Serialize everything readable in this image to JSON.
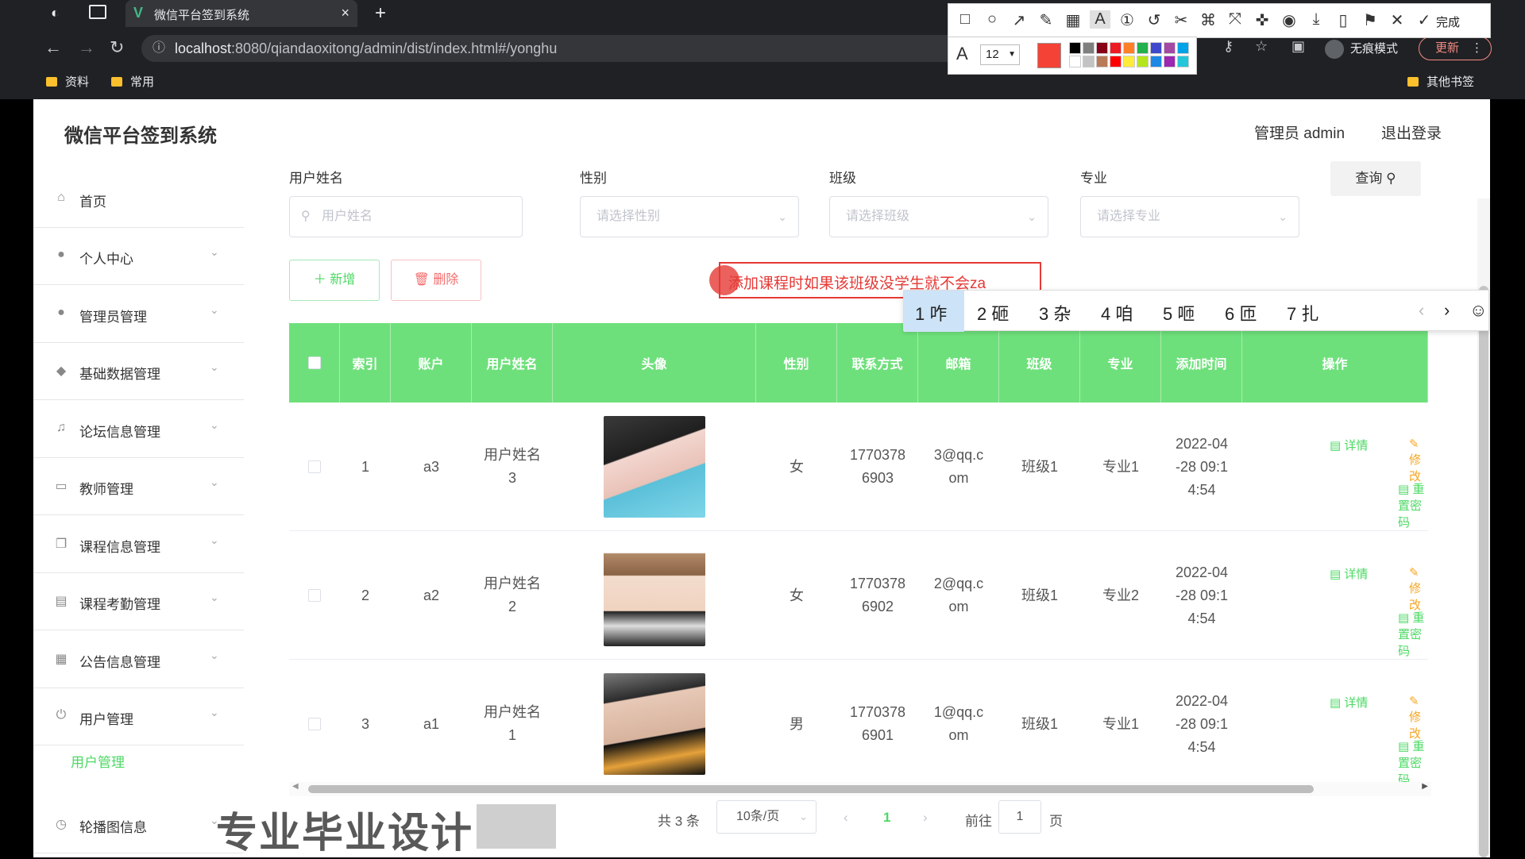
{
  "browser": {
    "tab_title": "微信平台签到系统",
    "tab_close": "×",
    "new_tab": "+",
    "url_host": "localhost",
    "url_rest": ":8080/qiandaoxitong/admin/dist/index.html#/yonghu",
    "bookmarks": [
      "资料",
      "常用"
    ],
    "other_bookmarks": "其他书签",
    "incognito_label": "无痕模式",
    "update_label": "更新"
  },
  "annotation_toolbar": {
    "font_size": "12",
    "done_label": "完成",
    "current_color": "#f44336"
  },
  "header": {
    "system_title": "微信平台签到系统",
    "admin_label": "管理员 admin",
    "logout_label": "退出登录"
  },
  "sidebar": {
    "items": [
      {
        "label": "首页",
        "icon": "home-icon"
      },
      {
        "label": "个人中心",
        "icon": "user-icon"
      },
      {
        "label": "管理员管理",
        "icon": "user-icon"
      },
      {
        "label": "基础数据管理",
        "icon": "pin-icon"
      },
      {
        "label": "论坛信息管理",
        "icon": "mic-icon"
      },
      {
        "label": "教师管理",
        "icon": "chat-icon"
      },
      {
        "label": "课程信息管理",
        "icon": "copy-icon"
      },
      {
        "label": "课程考勤管理",
        "icon": "doc-icon"
      },
      {
        "label": "公告信息管理",
        "icon": "grid-icon"
      },
      {
        "label": "用户管理",
        "icon": "power-icon"
      },
      {
        "label": "轮播图信息",
        "icon": "clock-icon"
      }
    ],
    "active_submenu": "用户管理"
  },
  "filters": {
    "name_label": "用户姓名",
    "name_placeholder": "用户姓名",
    "gender_label": "性别",
    "gender_placeholder": "请选择性别",
    "class_label": "班级",
    "class_placeholder": "请选择班级",
    "major_label": "专业",
    "major_placeholder": "请选择专业",
    "query_label": "查询"
  },
  "actions": {
    "add_label": "新增",
    "delete_label": "删除"
  },
  "annotation": {
    "text": "添加课程时如果该班级没学生就不会za"
  },
  "ime": {
    "candidates": [
      "1 咋",
      "2 砸",
      "3 杂",
      "4 咱",
      "5 咂",
      "6 匝",
      "7 扎"
    ]
  },
  "table": {
    "columns": [
      "索引",
      "账户",
      "用户姓名",
      "头像",
      "性别",
      "联系方式",
      "邮箱",
      "班级",
      "专业",
      "添加时间",
      "操作"
    ],
    "rows": [
      {
        "index": "1",
        "account": "a3",
        "name": "用户姓名3",
        "gender": "女",
        "phone": "17703786903",
        "email": "3@qq.com",
        "class": "班级1",
        "major": "专业1",
        "time": "2022-04-28 09:14:54"
      },
      {
        "index": "2",
        "account": "a2",
        "name": "用户姓名2",
        "gender": "女",
        "phone": "17703786902",
        "email": "2@qq.com",
        "class": "班级1",
        "major": "专业2",
        "time": "2022-04-28 09:14:54"
      },
      {
        "index": "3",
        "account": "a1",
        "name": "用户姓名1",
        "gender": "男",
        "phone": "17703786901",
        "email": "1@qq.com",
        "class": "班级1",
        "major": "专业1",
        "time": "2022-04-28 09:14:54"
      }
    ],
    "op_detail": "详情",
    "op_edit": "修改",
    "op_reset": "重置密码"
  },
  "pagination": {
    "total": "共 3 条",
    "page_size": "10条/页",
    "current_page": "1",
    "goto_label": "前往",
    "goto_value": "1",
    "page_suffix": "页"
  },
  "watermark": {
    "text": "专业毕业设计"
  }
}
